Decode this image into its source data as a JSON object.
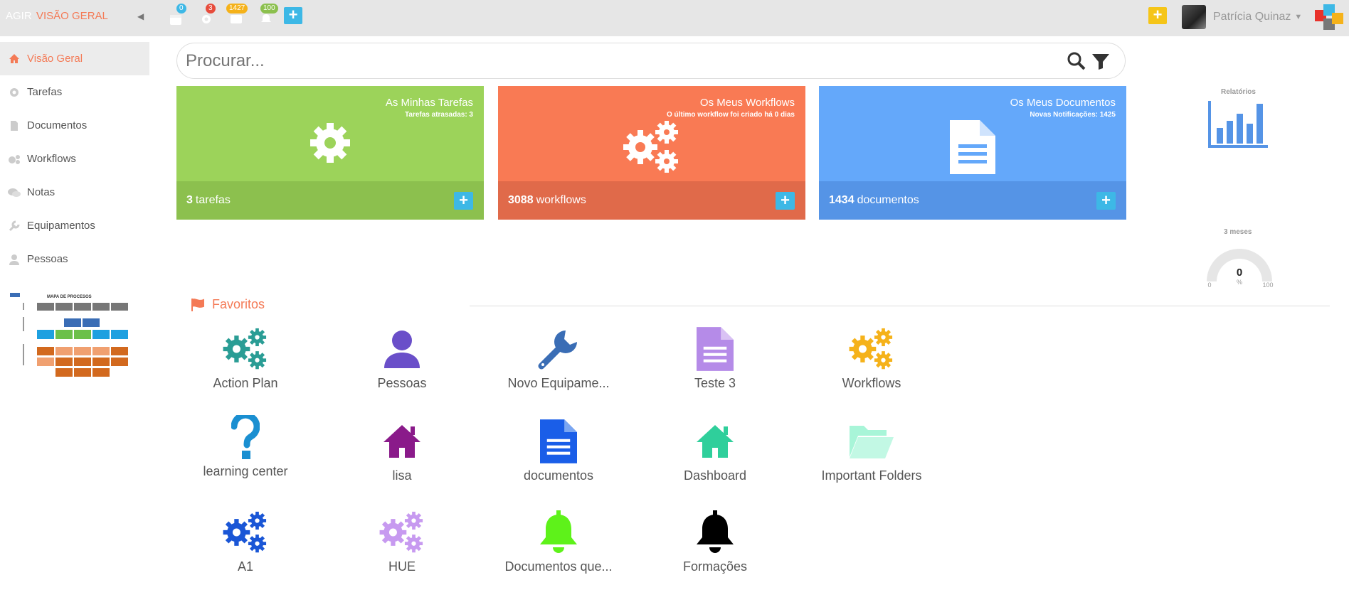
{
  "topbar": {
    "brand_left": "AGIR",
    "brand_right": "VISÃO GERAL",
    "badges": {
      "calendar": "0",
      "tasks": "3",
      "messages": "1427",
      "notifications": "100"
    },
    "user_name": "Patrícia Quinaz"
  },
  "sidebar": {
    "items": [
      {
        "label": "Visão Geral",
        "icon": "home-icon"
      },
      {
        "label": "Tarefas",
        "icon": "gear-icon"
      },
      {
        "label": "Documentos",
        "icon": "document-icon"
      },
      {
        "label": "Workflows",
        "icon": "gears-icon"
      },
      {
        "label": "Notas",
        "icon": "comments-icon"
      },
      {
        "label": "Equipamentos",
        "icon": "wrench-icon"
      },
      {
        "label": "Pessoas",
        "icon": "user-icon"
      }
    ],
    "map_title": "MAPA DE PROCESOS"
  },
  "search": {
    "placeholder": "Procurar..."
  },
  "cards": [
    {
      "title": "As Minhas Tarefas",
      "subtitle": "Tarefas atrasadas: 3",
      "count": "3",
      "unit": "tarefas",
      "color": "#9cd35a",
      "footer_color": "#8cc04e"
    },
    {
      "title": "Os Meus Workflows",
      "subtitle": "O último workflow foi criado há 0 dias",
      "count": "3088",
      "unit": "workflows",
      "color": "#f97a54",
      "footer_color": "#e06a4a"
    },
    {
      "title": "Os Meus Documentos",
      "subtitle": "Novas Notificações: 1425",
      "count": "1434",
      "unit": "documentos",
      "color": "#64a8fa",
      "footer_color": "#5594e6"
    }
  ],
  "widgets": {
    "reports_label": "Relatórios",
    "gauge_label": "3 meses",
    "gauge_value": "0",
    "gauge_unit": "%",
    "gauge_min": "0",
    "gauge_max": "100"
  },
  "favorites": {
    "title": "Favoritos",
    "items": [
      {
        "label": "Action Plan",
        "icon": "gears-icon",
        "color": "#2a9d95"
      },
      {
        "label": "Pessoas",
        "icon": "user-icon",
        "color": "#6a4fc9"
      },
      {
        "label": "Novo Equipame...",
        "icon": "wrench-icon",
        "color": "#3a6db5"
      },
      {
        "label": "Teste 3",
        "icon": "document-icon",
        "color": "#b58be8"
      },
      {
        "label": "Workflows",
        "icon": "gears-icon",
        "color": "#f5b21a"
      },
      {
        "label": "learning center",
        "icon": "question-icon",
        "color": "#1a8fd1"
      },
      {
        "label": "lisa",
        "icon": "home-icon",
        "color": "#8a1a8a"
      },
      {
        "label": "documentos",
        "icon": "document-icon",
        "color": "#1a5ee8"
      },
      {
        "label": "Dashboard",
        "icon": "home-icon",
        "color": "#2fcf9b"
      },
      {
        "label": "Important Folders",
        "icon": "folder-open-icon",
        "color": "#a8f5d8"
      },
      {
        "label": "A1",
        "icon": "gears-icon",
        "color": "#1a56d6"
      },
      {
        "label": "HUE",
        "icon": "gears-icon",
        "color": "#c79af0"
      },
      {
        "label": "Documentos que...",
        "icon": "bell-icon",
        "color": "#5ef21a"
      },
      {
        "label": "Formações",
        "icon": "bell-icon",
        "color": "#000000"
      }
    ]
  }
}
